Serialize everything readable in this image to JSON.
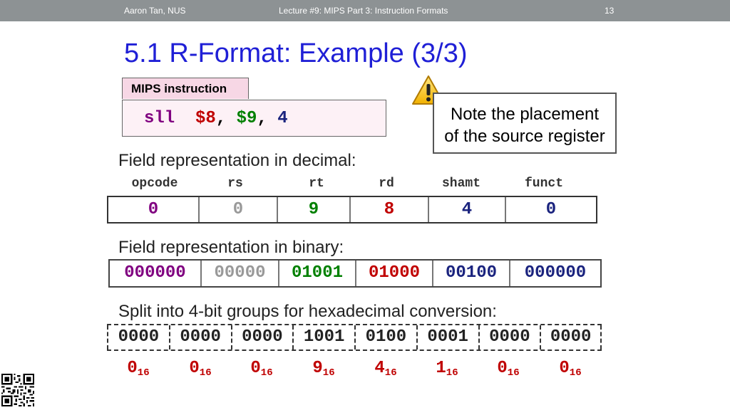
{
  "header": {
    "author": "Aaron Tan, NUS",
    "lecture": "Lecture #9: MIPS Part 3: Instruction Formats",
    "page": "13"
  },
  "title": "5.1 R-Format: Example (3/3)",
  "instruction_box": {
    "tab_label": "MIPS instruction",
    "mnemonic": "sll",
    "rd": "$8",
    "sep1": ",",
    "rt": "$9",
    "sep2": ",",
    "shamt": "4"
  },
  "note": {
    "line1": "Note the placement",
    "line2": "of the source register",
    "icon": "warning-icon"
  },
  "decimal_section": {
    "label": "Field representation in decimal:",
    "headers": [
      "opcode",
      "rs",
      "rt",
      "rd",
      "shamt",
      "funct"
    ],
    "values": [
      "0",
      "0",
      "9",
      "8",
      "4",
      "0"
    ]
  },
  "binary_section": {
    "label": "Field representation in binary:",
    "values": [
      "000000",
      "00000",
      "01001",
      "01000",
      "00100",
      "000000"
    ]
  },
  "hex_section": {
    "label": "Split into 4-bit groups for hexadecimal conversion:",
    "groups": [
      "0000",
      "0000",
      "0000",
      "1001",
      "0100",
      "0001",
      "0000",
      "0000"
    ],
    "digits": [
      "0",
      "0",
      "0",
      "9",
      "4",
      "1",
      "0",
      "0"
    ],
    "base": "16"
  },
  "colors": {
    "title": "#1f1fd6",
    "opcode": "#800080",
    "rs": "#999999",
    "rt": "#008000",
    "rd": "#c00000",
    "shamt": "#1a237e",
    "funct": "#1a237e",
    "hex_digits": "#c00000"
  }
}
